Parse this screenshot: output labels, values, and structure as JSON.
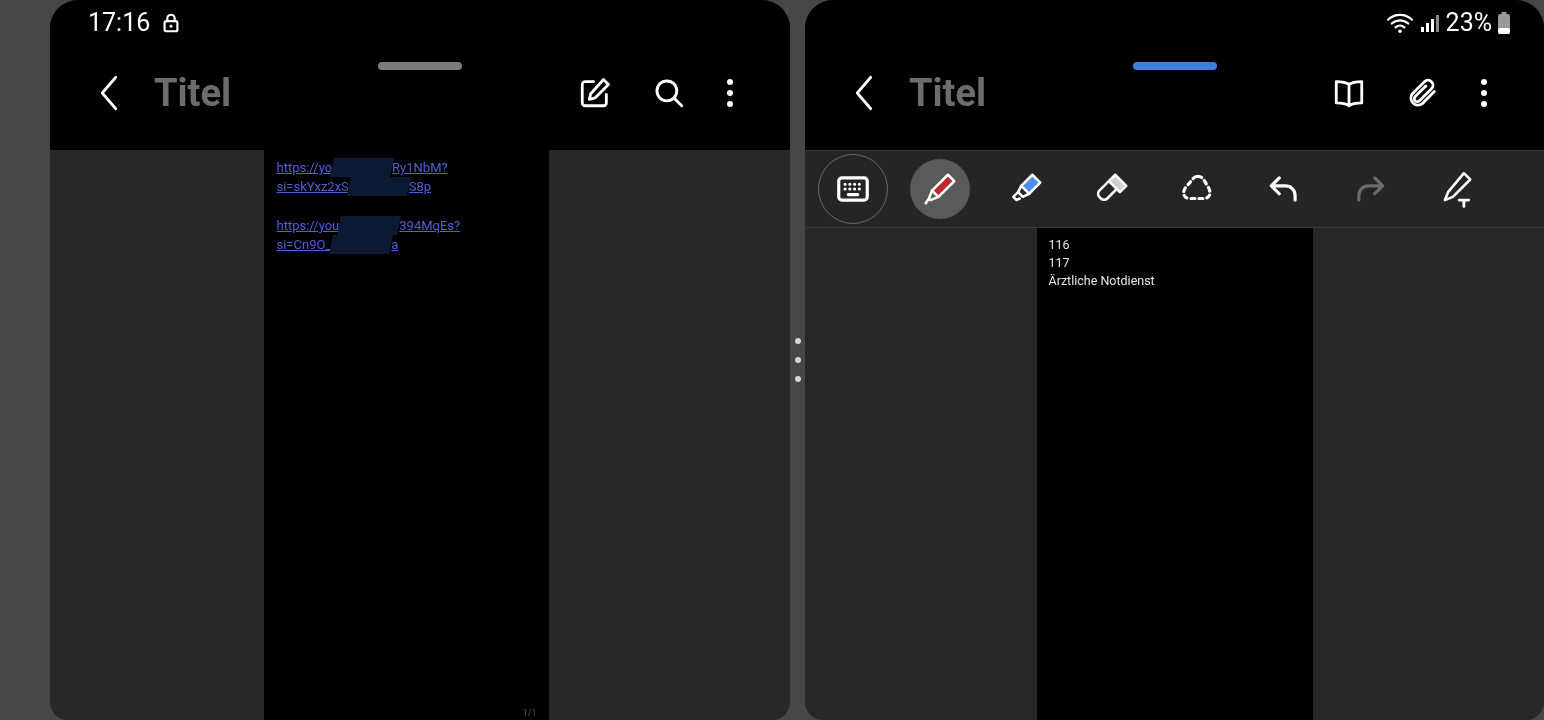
{
  "left_window": {
    "status_bar": {
      "time": "17:16"
    },
    "title": "Titel",
    "toolbar": [
      {
        "kind": "edit"
      },
      {
        "kind": "search"
      },
      {
        "kind": "more"
      }
    ],
    "page": {
      "links": [
        {
          "lines": [
            [
              "https://yo",
              "Ry1NbM?"
            ],
            [
              "si=skYxz2xS",
              "S8p"
            ]
          ]
        },
        {
          "lines": [
            [
              "https://you",
              "394MqEs?"
            ],
            [
              "si=Cn9O_",
              "a"
            ]
          ]
        }
      ],
      "page_number": "1/1"
    }
  },
  "right_window": {
    "status_bar": {
      "battery": "23%"
    },
    "title": "Titel",
    "toolbar": [
      {
        "kind": "book"
      },
      {
        "kind": "attach"
      },
      {
        "kind": "more"
      }
    ],
    "tools": [
      {
        "kind": "keyboard",
        "selected": false,
        "disabled": false
      },
      {
        "kind": "pen",
        "selected": true,
        "disabled": false
      },
      {
        "kind": "highlighter",
        "selected": false,
        "disabled": false
      },
      {
        "kind": "eraser",
        "selected": false,
        "disabled": false
      },
      {
        "kind": "lasso",
        "selected": false,
        "disabled": false
      },
      {
        "kind": "undo",
        "selected": false,
        "disabled": false
      },
      {
        "kind": "redo",
        "selected": false,
        "disabled": true
      },
      {
        "kind": "pen-text",
        "selected": false,
        "disabled": false
      }
    ],
    "page": {
      "lines": [
        "116",
        "117",
        "Ärztliche Notdienst"
      ]
    }
  }
}
